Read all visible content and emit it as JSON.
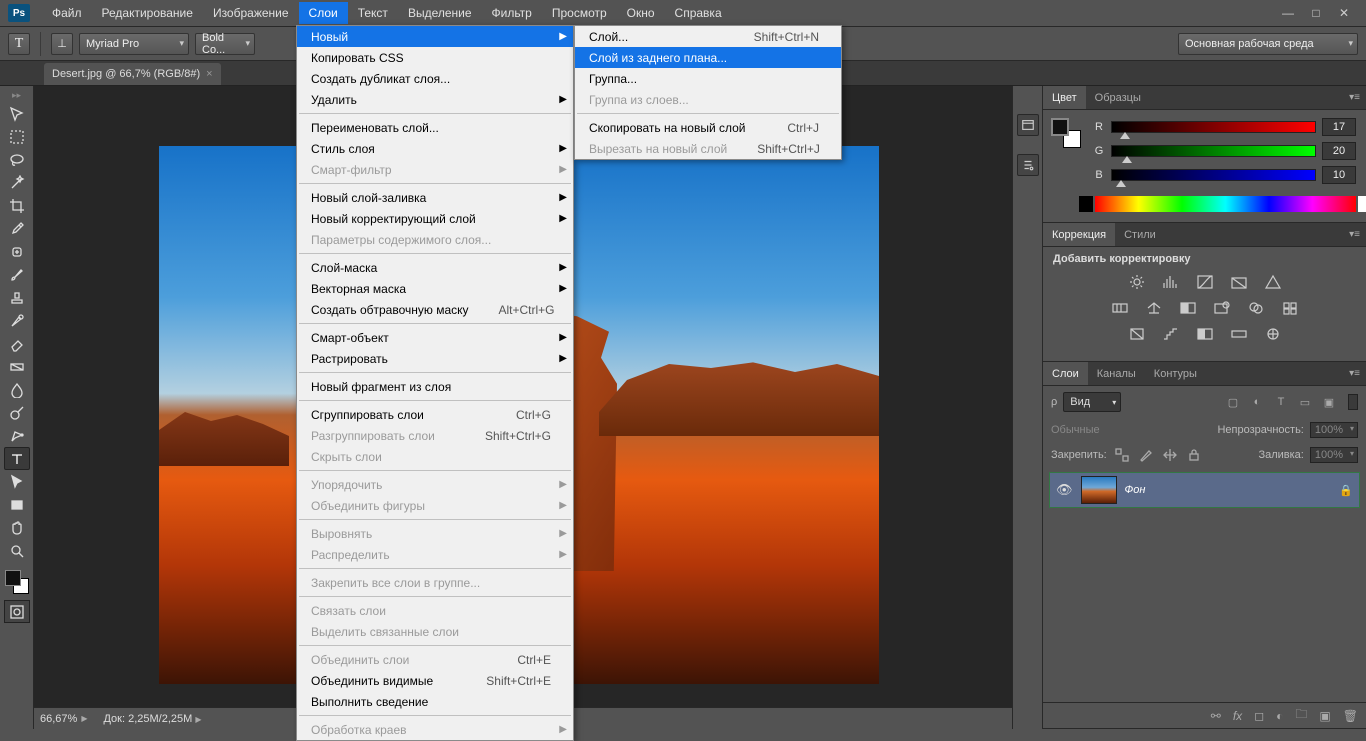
{
  "menubar": {
    "items": [
      "Файл",
      "Редактирование",
      "Изображение",
      "Слои",
      "Текст",
      "Выделение",
      "Фильтр",
      "Просмотр",
      "Окно",
      "Справка"
    ],
    "open_index": 3
  },
  "optionsbar": {
    "font": "Myriad Pro",
    "style": "Bold Co...",
    "workspace": "Основная рабочая среда"
  },
  "doc_tab": {
    "title": "Desert.jpg @ 66,7% (RGB/8#)"
  },
  "statusbar": {
    "zoom": "66,67%",
    "doc": "Док: 2,25M/2,25M"
  },
  "menus": {
    "layers": [
      {
        "t": "Новый",
        "arrow": true,
        "hl": true
      },
      {
        "t": "Копировать CSS"
      },
      {
        "t": "Создать дубликат слоя..."
      },
      {
        "t": "Удалить",
        "arrow": true
      },
      {
        "sep": true
      },
      {
        "t": "Переименовать слой..."
      },
      {
        "t": "Стиль слоя",
        "arrow": true
      },
      {
        "t": "Смарт-фильтр",
        "arrow": true,
        "dis": true
      },
      {
        "sep": true
      },
      {
        "t": "Новый слой-заливка",
        "arrow": true
      },
      {
        "t": "Новый корректирующий слой",
        "arrow": true
      },
      {
        "t": "Параметры содержимого слоя...",
        "dis": true
      },
      {
        "sep": true
      },
      {
        "t": "Слой-маска",
        "arrow": true
      },
      {
        "t": "Векторная маска",
        "arrow": true
      },
      {
        "t": "Создать обтравочную маску",
        "sc": "Alt+Ctrl+G"
      },
      {
        "sep": true
      },
      {
        "t": "Смарт-объект",
        "arrow": true
      },
      {
        "t": "Растрировать",
        "arrow": true
      },
      {
        "sep": true
      },
      {
        "t": "Новый фрагмент из слоя"
      },
      {
        "sep": true
      },
      {
        "t": "Сгруппировать слои",
        "sc": "Ctrl+G"
      },
      {
        "t": "Разгруппировать слои",
        "sc": "Shift+Ctrl+G",
        "dis": true
      },
      {
        "t": "Скрыть слои",
        "dis": true
      },
      {
        "sep": true
      },
      {
        "t": "Упорядочить",
        "arrow": true,
        "dis": true
      },
      {
        "t": "Объединить фигуры",
        "arrow": true,
        "dis": true
      },
      {
        "sep": true
      },
      {
        "t": "Выровнять",
        "arrow": true,
        "dis": true
      },
      {
        "t": "Распределить",
        "arrow": true,
        "dis": true
      },
      {
        "sep": true
      },
      {
        "t": "Закрепить все слои в группе...",
        "dis": true
      },
      {
        "sep": true
      },
      {
        "t": "Связать слои",
        "dis": true
      },
      {
        "t": "Выделить связанные слои",
        "dis": true
      },
      {
        "sep": true
      },
      {
        "t": "Объединить слои",
        "sc": "Ctrl+E",
        "dis": true
      },
      {
        "t": "Объединить видимые",
        "sc": "Shift+Ctrl+E"
      },
      {
        "t": "Выполнить сведение"
      },
      {
        "sep": true
      },
      {
        "t": "Обработка краев",
        "arrow": true,
        "dis": true
      }
    ],
    "new": [
      {
        "t": "Слой...",
        "sc": "Shift+Ctrl+N"
      },
      {
        "t": "Слой из заднего плана...",
        "hl": true
      },
      {
        "t": "Группа..."
      },
      {
        "t": "Группа из слоев...",
        "dis": true
      },
      {
        "sep": true
      },
      {
        "t": "Скопировать на новый слой",
        "sc": "Ctrl+J"
      },
      {
        "t": "Вырезать на новый слой",
        "sc": "Shift+Ctrl+J",
        "dis": true
      }
    ]
  },
  "panels": {
    "color": {
      "tabs": [
        "Цвет",
        "Образцы"
      ],
      "r": 17,
      "g": 20,
      "b": 10,
      "labels": {
        "r": "R",
        "g": "G",
        "b": "B"
      }
    },
    "adjustments": {
      "tabs": [
        "Коррекция",
        "Стили"
      ],
      "title": "Добавить корректировку"
    },
    "layers": {
      "tabs": [
        "Слои",
        "Каналы",
        "Контуры"
      ],
      "filter": "Вид",
      "blend": "Обычные",
      "opacity_label": "Непрозрачность:",
      "opacity": "100%",
      "lock_label": "Закрепить:",
      "fill_label": "Заливка:",
      "fill": "100%",
      "layer_name": "Фон"
    }
  }
}
